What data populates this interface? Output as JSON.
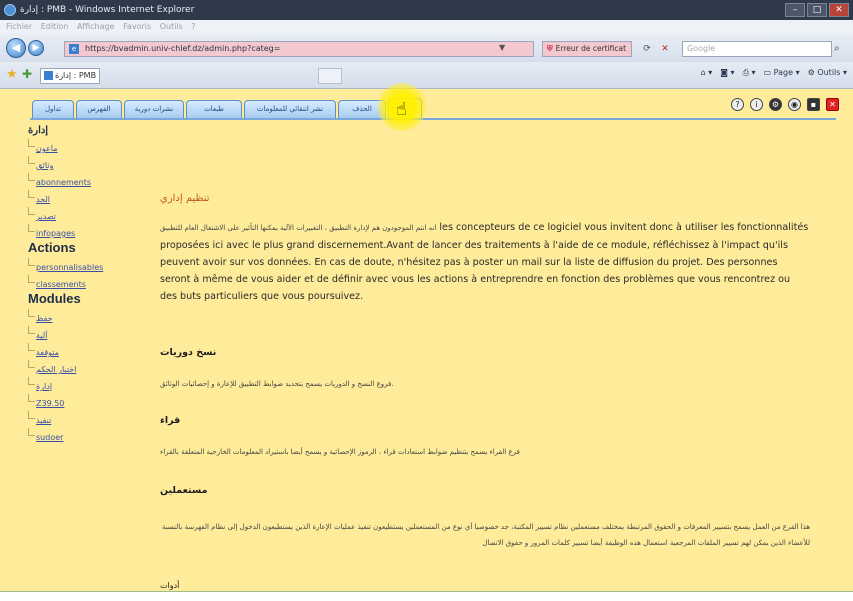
{
  "browser": {
    "window_title": "إدارة : PMB - Windows Internet Explorer",
    "menu": [
      "Fichier",
      "Edition",
      "Affichage",
      "Favoris",
      "Outils",
      "?"
    ],
    "address_url": "https://bvadmin.univ-chlef.dz/admin.php?categ=",
    "certificate_error": "Erreur de certificat",
    "search_placeholder": "Google",
    "tab_title": "إدارة : PMB",
    "command_bar": [
      "Page",
      "Outils"
    ]
  },
  "app_tabs": [
    "تداول",
    "الفهرس",
    "نشرات دورية",
    "طبعات",
    "نشر انتقائي للمعلومات",
    "الحذف",
    ""
  ],
  "toolbar_icons": [
    "help-icon",
    "info-icon",
    "settings-icon",
    "eye-icon",
    "save-icon",
    "close-icon"
  ],
  "sidebar": {
    "heading_admin": "إدارة",
    "admin_items": [
      "ماعون",
      "وثائق",
      "abonnements",
      "الحد",
      "تصدير",
      "infopages"
    ],
    "heading_actions": "Actions",
    "action_items": [
      "personnalisables",
      "classements"
    ],
    "heading_modules": "Modules",
    "module_items": [
      "حفظ",
      "آلية",
      "متوقفة",
      "اختبار الحكم",
      "إدارة",
      "Z39.50",
      "تنفيذ",
      "sudoer"
    ]
  },
  "main": {
    "title": "تنظيم إداري",
    "intro_arabic": "انه انتم الموجودون هم لإدارة التطبيق ، التغييرات الآلية يمكنها التأثير على الاشتغال العام للتطبيق",
    "intro_text": "les concepteurs de ce logiciel vous invitent donc à utiliser les fonctionnalités proposées ici avec le plus grand discernement.Avant de lancer des traitements à l'aide de ce module, réfléchissez à l'impact qu'ils peuvent avoir sur vos données. En cas de doute, n'hésitez pas à poster un mail sur la liste de diffusion du projet. Des personnes seront à même de vous aider et de définir avec vous les actions à entreprendre en fonction des problèmes que vous rencontrez ou des buts particuliers que vous poursuivez.",
    "sections": [
      {
        "heading": "نسخ دوريات",
        "text": "فروع النسخ و الدوريات يسمح بتحديد ضوابط التطبيق للإعارة و إحصائيات الوثائق."
      },
      {
        "heading": "قراء",
        "text": "فرع القراء يسمح بتنظيم ضوابط استعادات قراء ، الرموز الإحصائية و يسمح أيضا باستيراد المعلومات الخارجية المتعلقة بالقراء"
      },
      {
        "heading": "مستعملين",
        "text": "هذا الفرع من العمل يسمح بتسيير المعرفات و الحقوق المرتبطة بمختلف مستعملين نظام تسيير المكتبة، جد خصوصيا أي نوع من المستعملين يستطيعون تنفيذ عمليات الإعارة الذين يستطيعون الدخول إلى نظام الفهرسة بالنسبة للأعضاء الذين يمكن لهم تسيير الملفات المرجعية استعمال هذه الوظيفة أيضا تسيير كلمات المرور و حقوق الاتصال"
      },
      {
        "heading": "أدوات",
        "text": ""
      }
    ]
  }
}
